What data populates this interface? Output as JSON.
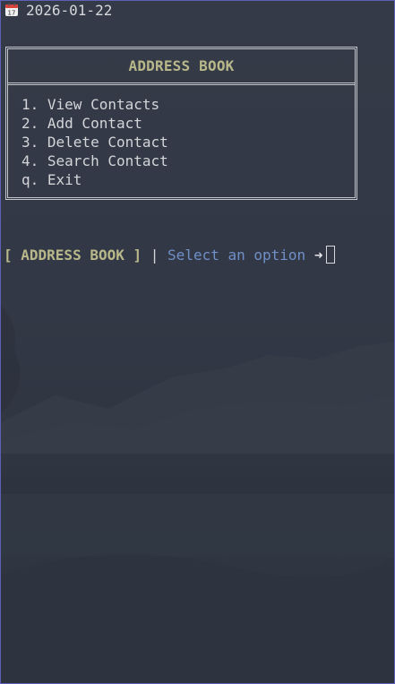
{
  "header": {
    "icon": "calendar-icon",
    "date": "2026-01-22"
  },
  "menu": {
    "title": "ADDRESS BOOK",
    "items": [
      {
        "label": "1. View Contacts"
      },
      {
        "label": "2. Add Contact"
      },
      {
        "label": "3. Delete Contact"
      },
      {
        "label": "4. Search Contact"
      },
      {
        "label": "q. Exit"
      }
    ]
  },
  "prompt": {
    "context": "[ ADDRESS BOOK ]",
    "separator": "|",
    "text": "Select an option",
    "arrow": "➜"
  },
  "colors": {
    "background": "#343a46",
    "accent": "#b9b88a",
    "prompt_text": "#6f90c8",
    "foreground": "#d3d5d9",
    "window_border": "#5e5fb6"
  }
}
